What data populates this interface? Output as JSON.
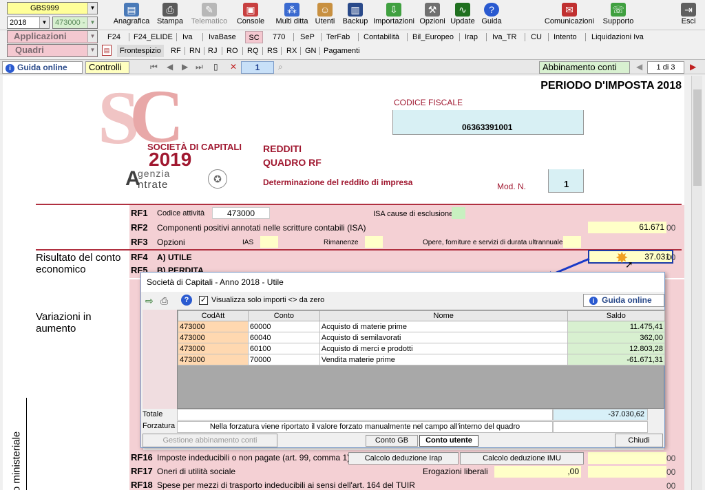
{
  "toolbar": {
    "company_code": "GBS999",
    "year": "2018",
    "activity_code": "473000 -",
    "applicazioni_label": "Applicazioni",
    "quadri_label": "Quadri",
    "buttons": [
      {
        "label": "Anagrafica",
        "icon": "address-book-icon",
        "color": "#4a7ab8"
      },
      {
        "label": "Stampa",
        "icon": "printer-icon",
        "color": "#5a5a5a"
      },
      {
        "label": "Telematico",
        "icon": "telematic-icon",
        "color": "#a0a0a0",
        "disabled": true
      },
      {
        "label": "Console",
        "icon": "console-icon",
        "color": "#c84040"
      },
      {
        "label": "Multi ditta",
        "icon": "multi-company-icon",
        "color": "#3a6ad0"
      },
      {
        "label": "Utenti",
        "icon": "users-icon",
        "color": "#c89040"
      },
      {
        "label": "Backup",
        "icon": "backup-icon",
        "color": "#2a4a8a"
      },
      {
        "label": "Importazioni",
        "icon": "import-icon",
        "color": "#40a040"
      },
      {
        "label": "Opzioni",
        "icon": "wrench-icon",
        "color": "#707070"
      },
      {
        "label": "Update",
        "icon": "update-icon",
        "color": "#207020"
      },
      {
        "label": "Guida",
        "icon": "help-icon",
        "color": "#2a5ad0"
      },
      {
        "label": "Comunicazioni",
        "icon": "communications-icon",
        "color": "#c03030"
      },
      {
        "label": "Supporto",
        "icon": "support-icon",
        "color": "#40a040"
      },
      {
        "label": "Esci",
        "icon": "exit-icon",
        "color": "#606060"
      }
    ]
  },
  "app_tabs": [
    "F24",
    "F24_ELIDE",
    "Iva",
    "IvaBase",
    "SC",
    "770",
    "SeP",
    "TerFab",
    "Contabilità",
    "Bil_Europeo",
    "Irap",
    "Iva_TR",
    "CU",
    "Intento",
    "Liquidazioni Iva"
  ],
  "quadri_tabs": [
    "Frontespizio",
    "RF",
    "RN",
    "RJ",
    "RO",
    "RQ",
    "RS",
    "RX",
    "GN",
    "Pagamenti"
  ],
  "navbar": {
    "guida_online": "Guida online",
    "controlli": "Controlli",
    "page_number": "1",
    "abbinamento": "Abbinamento conti",
    "page_of": "1 di 3"
  },
  "form": {
    "period_title": "PERIODO D'IMPOSTA 2018",
    "codice_fiscale_label": "CODICE FISCALE",
    "codice_fiscale": "06363391001",
    "brand_line1": "SOCIETÀ DI CAPITALI",
    "brand_year": "2019",
    "agency_line1": "genzia",
    "agency_line2": "ntrate",
    "title1": "REDDITI",
    "title2": "QUADRO RF",
    "subtitle": "Determinazione del reddito di impresa",
    "mod_label": "Mod. N.",
    "mod_value": "1",
    "side_group1": "Risultato del conto economico",
    "side_group2": "Variazioni in aumento",
    "side_vertical": "dello ministeriale",
    "rows": {
      "rf1_code": "RF1",
      "rf1_desc": "Codice attività",
      "rf1_value": "473000",
      "rf1_isa": "ISA cause di esclusione",
      "rf2_code": "RF2",
      "rf2_desc": "Componenti positivi annotati nelle scritture contabili (ISA)",
      "rf2_value": "61.671",
      "rf3_code": "RF3",
      "rf3_desc": "Opzioni",
      "rf3_ias": "IAS",
      "rf3_rim": "Rimanenze",
      "rf3_opere": "Opere, forniture e servizi di durata ultrannuale",
      "rf4_code": "RF4",
      "rf4_desc": "A) UTILE",
      "rf4_value": "37.031",
      "rf5_code": "RF5",
      "rf5_desc": "B) PERDITA",
      "rf16_code": "RF16",
      "rf16_desc": "Imposte indeducibili o non pagate (art. 99, comma 1)",
      "rf17_code": "RF17",
      "rf17_desc": "Oneri di utilità sociale",
      "rf17_erog": "Erogazioni liberali",
      "rf17_value": ",00",
      "rf18_code": "RF18",
      "rf18_desc": "Spese per mezzi di trasporto indeducibili ai sensi dell'art. 164 del TUIR",
      "btn_irap": "Calcolo deduzione Irap",
      "btn_imu": "Calcolo deduzione IMU",
      "cents": "00"
    }
  },
  "dialog": {
    "title": "Società di Capitali - Anno 2018 - Utile",
    "checkbox_label": "Visualizza solo importi <> da zero",
    "checkbox_checked": true,
    "guida_online": "Guida online",
    "columns": [
      "CodAtt",
      "Conto",
      "Nome",
      "Saldo"
    ],
    "rows": [
      {
        "codatt": "473000",
        "conto": "60000",
        "nome": "Acquisto di materie prime",
        "saldo": "11.475,41"
      },
      {
        "codatt": "473000",
        "conto": "60040",
        "nome": "Acquisto di semilavorati",
        "saldo": "362,00"
      },
      {
        "codatt": "473000",
        "conto": "60100",
        "nome": "Acquisto di merci e prodotti",
        "saldo": "12.803,28"
      },
      {
        "codatt": "473000",
        "conto": "70000",
        "nome": "Vendita materie prime",
        "saldo": "-61.671,31"
      }
    ],
    "totale_label": "Totale",
    "totale_value": "-37.030,62",
    "forzatura_label": "Forzatura",
    "forzatura_note": "Nella forzatura viene riportato il valore forzato manualmente nel campo all'interno del quadro",
    "btn_gestione": "Gestione abbinamento conti",
    "btn_conto_gb": "Conto GB",
    "btn_conto_utente": "Conto utente",
    "btn_chiudi": "Chiudi"
  }
}
